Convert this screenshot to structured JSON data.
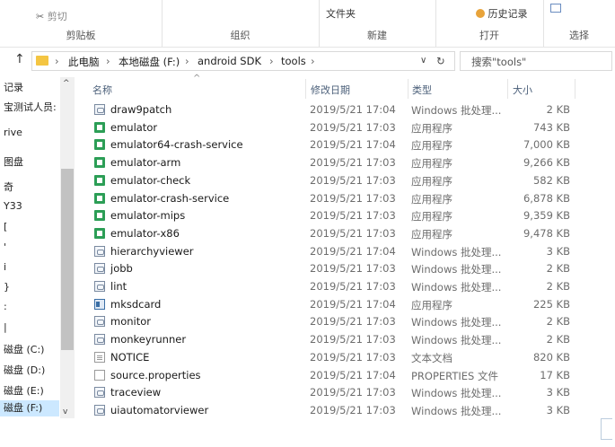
{
  "ribbon": {
    "cut": "剪切",
    "clipboard": "剪贴板",
    "organize": "组织",
    "new_folder": "文件夹",
    "new": "新建",
    "history": "历史记录",
    "open": "打开",
    "select": "选择"
  },
  "address": {
    "crumbs": [
      "此电脑",
      "本地磁盘 (F:)",
      "android SDK",
      "tools"
    ],
    "search_placeholder": "搜索\"tools\""
  },
  "sidebar": {
    "items": [
      {
        "label": "记录"
      },
      {
        "label": "宝测试人员:"
      },
      {
        "label": "rive"
      },
      {
        "label": "图盘"
      },
      {
        "label": "奇"
      },
      {
        "label": "Y33"
      },
      {
        "label": "["
      },
      {
        "label": "'"
      },
      {
        "label": "i"
      },
      {
        "label": "}"
      },
      {
        "label": ":"
      },
      {
        "label": "|"
      },
      {
        "label": "磁盘 (C:)"
      },
      {
        "label": "磁盘 (D:)"
      },
      {
        "label": "磁盘 (E:)"
      },
      {
        "label": "磁盘 (F:)"
      }
    ]
  },
  "columns": {
    "name": "名称",
    "date": "修改日期",
    "type": "类型",
    "size": "大小"
  },
  "files": [
    {
      "name": "draw9patch",
      "date": "2019/5/21 17:04",
      "type": "Windows 批处理...",
      "size": "2 KB",
      "icon": "batch-file-icon"
    },
    {
      "name": "emulator",
      "date": "2019/5/21 17:03",
      "type": "应用程序",
      "size": "743 KB",
      "icon": "application-icon"
    },
    {
      "name": "emulator64-crash-service",
      "date": "2019/5/21 17:04",
      "type": "应用程序",
      "size": "7,000 KB",
      "icon": "application-icon"
    },
    {
      "name": "emulator-arm",
      "date": "2019/5/21 17:03",
      "type": "应用程序",
      "size": "9,266 KB",
      "icon": "application-icon"
    },
    {
      "name": "emulator-check",
      "date": "2019/5/21 17:03",
      "type": "应用程序",
      "size": "582 KB",
      "icon": "application-icon"
    },
    {
      "name": "emulator-crash-service",
      "date": "2019/5/21 17:03",
      "type": "应用程序",
      "size": "6,878 KB",
      "icon": "application-icon"
    },
    {
      "name": "emulator-mips",
      "date": "2019/5/21 17:03",
      "type": "应用程序",
      "size": "9,359 KB",
      "icon": "application-icon"
    },
    {
      "name": "emulator-x86",
      "date": "2019/5/21 17:03",
      "type": "应用程序",
      "size": "9,478 KB",
      "icon": "application-icon"
    },
    {
      "name": "hierarchyviewer",
      "date": "2019/5/21 17:04",
      "type": "Windows 批处理...",
      "size": "3 KB",
      "icon": "batch-file-icon"
    },
    {
      "name": "jobb",
      "date": "2019/5/21 17:03",
      "type": "Windows 批处理...",
      "size": "2 KB",
      "icon": "batch-file-icon"
    },
    {
      "name": "lint",
      "date": "2019/5/21 17:03",
      "type": "Windows 批处理...",
      "size": "2 KB",
      "icon": "batch-file-icon"
    },
    {
      "name": "mksdcard",
      "date": "2019/5/21 17:04",
      "type": "应用程序",
      "size": "225 KB",
      "icon": "console-app-icon"
    },
    {
      "name": "monitor",
      "date": "2019/5/21 17:03",
      "type": "Windows 批处理...",
      "size": "2 KB",
      "icon": "batch-file-icon"
    },
    {
      "name": "monkeyrunner",
      "date": "2019/5/21 17:03",
      "type": "Windows 批处理...",
      "size": "2 KB",
      "icon": "batch-file-icon"
    },
    {
      "name": "NOTICE",
      "date": "2019/5/21 17:03",
      "type": "文本文档",
      "size": "820 KB",
      "icon": "text-file-icon"
    },
    {
      "name": "source.properties",
      "date": "2019/5/21 17:04",
      "type": "PROPERTIES 文件",
      "size": "17 KB",
      "icon": "generic-file-icon"
    },
    {
      "name": "traceview",
      "date": "2019/5/21 17:03",
      "type": "Windows 批处理...",
      "size": "3 KB",
      "icon": "batch-file-icon"
    },
    {
      "name": "uiautomatorviewer",
      "date": "2019/5/21 17:03",
      "type": "Windows 批处理...",
      "size": "3 KB",
      "icon": "batch-file-icon"
    }
  ]
}
